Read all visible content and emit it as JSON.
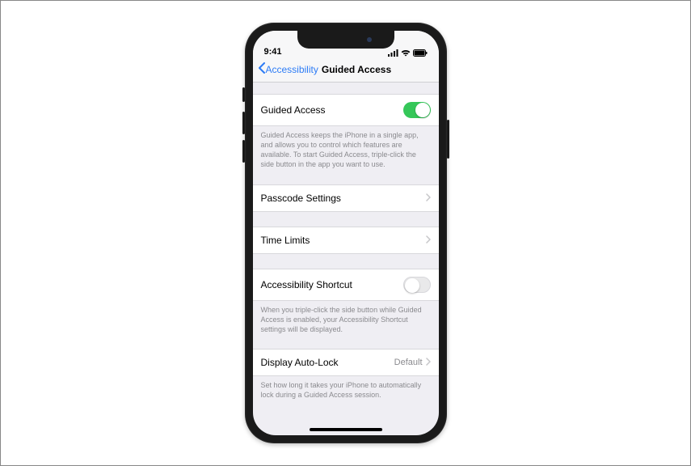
{
  "status": {
    "time": "9:41"
  },
  "nav": {
    "back": "Accessibility",
    "title": "Guided Access"
  },
  "guided_access": {
    "label": "Guided Access",
    "on": true,
    "footer": "Guided Access keeps the iPhone in a single app, and allows you to control which features are available. To start Guided Access, triple-click the side button in the app you want to use."
  },
  "passcode": {
    "label": "Passcode Settings"
  },
  "time_limits": {
    "label": "Time Limits"
  },
  "shortcut": {
    "label": "Accessibility Shortcut",
    "on": false,
    "footer": "When you triple-click the side button while Guided Access is enabled, your Accessibility Shortcut settings will be displayed."
  },
  "autolock": {
    "label": "Display Auto-Lock",
    "value": "Default",
    "footer": "Set how long it takes your iPhone to automatically lock during a Guided Access session."
  }
}
